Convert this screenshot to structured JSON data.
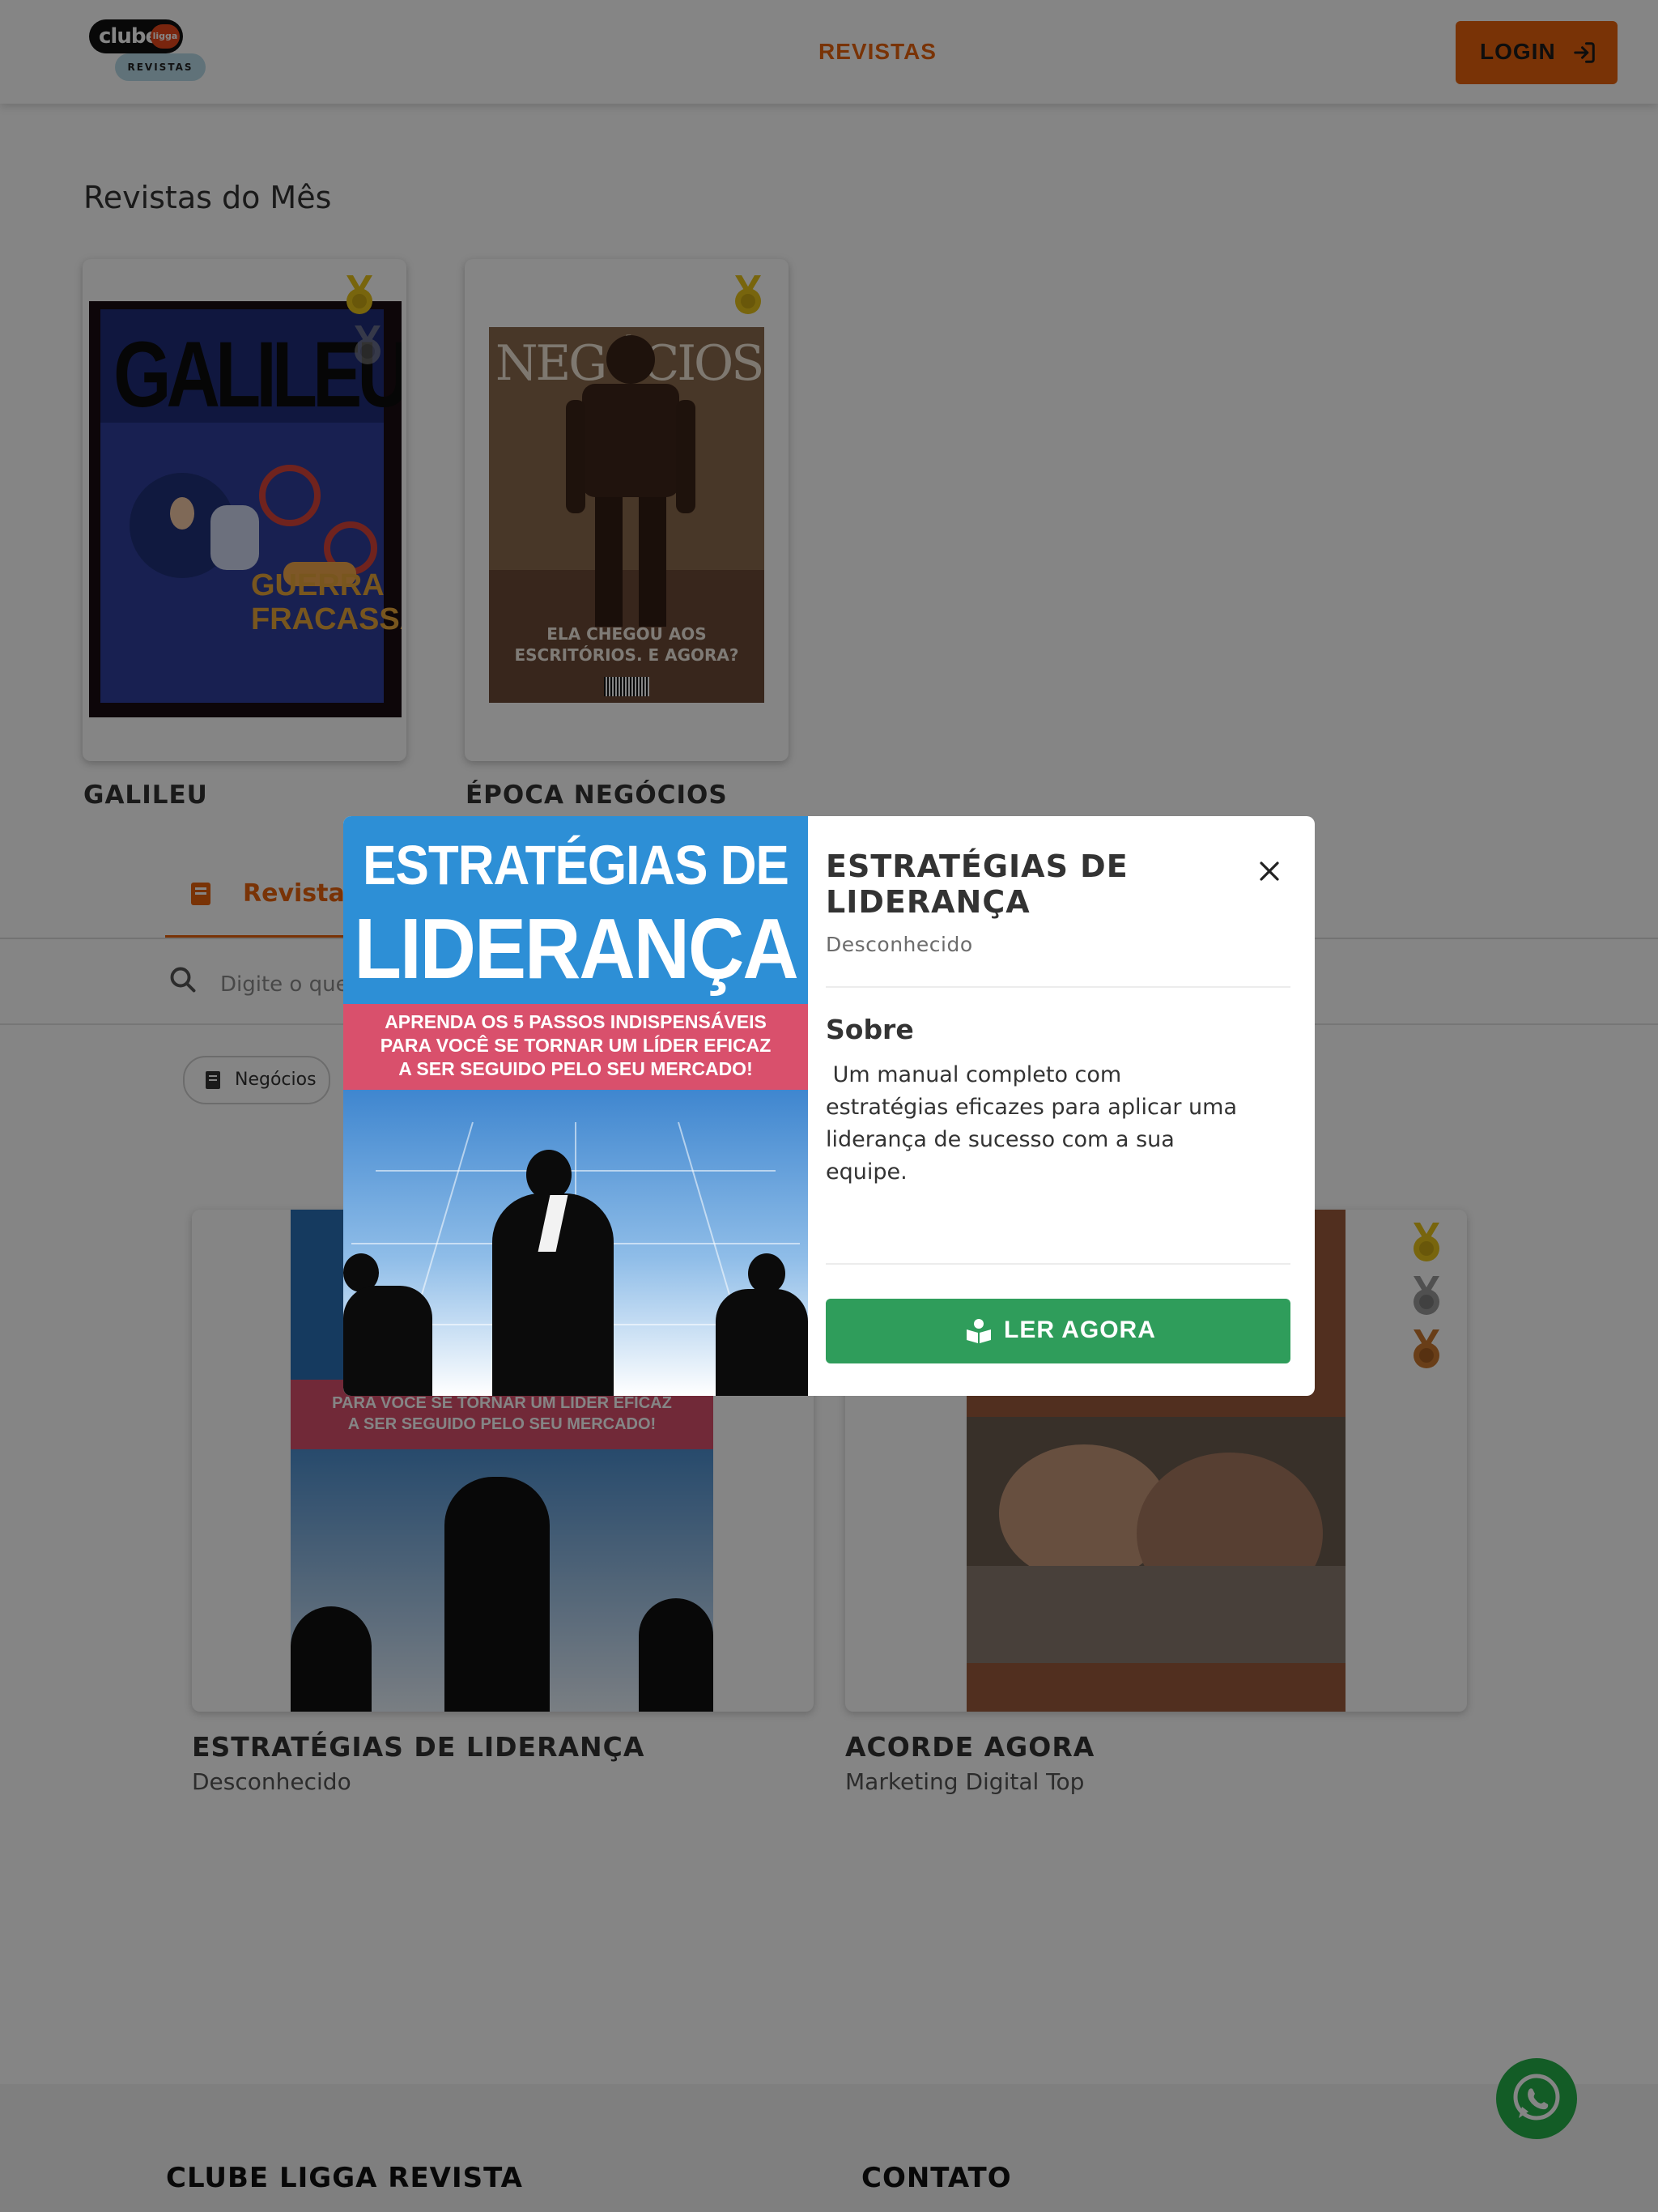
{
  "header": {
    "logo_main": "clube",
    "logo_dot": "ligga",
    "logo_sub": "REVISTAS",
    "nav_label": "REVISTAS",
    "login_label": "LOGIN"
  },
  "month_section": {
    "title": "Revistas do Mês",
    "magazines": [
      {
        "name": "GALILEU",
        "cover_title": "GALILEU",
        "cover_headline": "GUERRA FRACASSADA"
      },
      {
        "name": "ÉPOCA NEGÓCIOS",
        "cover_title": "NEGÓCIOS",
        "cover_headline": "ELA CHEGOU AOS ESCRITÓRIOS. E AGORA?"
      }
    ]
  },
  "tabs": {
    "active_label": "Revistas"
  },
  "search": {
    "placeholder": "Digite o que você procura..."
  },
  "filters": {
    "chip_label": "Negócios"
  },
  "list": {
    "items": [
      {
        "title": "ESTRATÉGIAS DE LIDERANÇA",
        "author": "Desconhecido",
        "cover_subtitle": "PARA VOCÊ SE TORNAR UM LÍDER EFICAZ\nA SER SEGUIDO PELO SEU MERCADO!"
      },
      {
        "title": "ACORDE AGORA",
        "author": "Marketing Digital Top"
      }
    ]
  },
  "footer": {
    "col1": "CLUBE LIGGA REVISTA",
    "col2": "CONTATO"
  },
  "modal": {
    "cover_line1": "ESTRATÉGIAS DE",
    "cover_line2": "LIDERANÇA",
    "cover_banner": "APRENDA OS 5 PASSOS INDISPENSÁVEIS\nPARA VOCÊ SE TORNAR UM LÍDER EFICAZ\nA SER SEGUIDO PELO SEU MERCADO!",
    "title": "ESTRATÉGIAS DE LIDERANÇA",
    "author": "Desconhecido",
    "about_label": "Sobre",
    "description": " Um manual completo com estratégias eficazes para aplicar uma liderança de sucesso com a sua equipe.",
    "read_label": "LER AGORA"
  },
  "colors": {
    "accent": "#e8620c",
    "read_button": "#2f9d5b",
    "whatsapp": "#25b04a",
    "medal_gold": "#e6c21a",
    "medal_silver": "#9a9a9a",
    "medal_bronze": "#c9772e"
  }
}
